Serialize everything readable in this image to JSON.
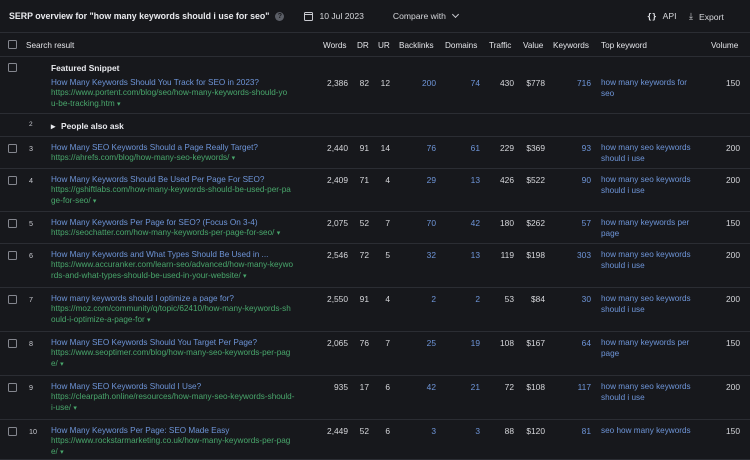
{
  "header": {
    "title": "SERP overview for \"how many keywords should i use for seo\"",
    "date": "10 Jul 2023",
    "compare_label": "Compare with",
    "api_label": "API",
    "export_label": "Export"
  },
  "columns": [
    "Search result",
    "Words",
    "DR",
    "UR",
    "Backlinks",
    "Domains",
    "Traffic",
    "Value",
    "Keywords",
    "Top keyword",
    "Volume"
  ],
  "featured": {
    "label": "Featured Snippet",
    "title": "How Many Keywords Should You Track for SEO in 2023?",
    "url_lines": [
      "https://www.portent.com/blog/seo/how-many-keywords-should-yo",
      "u-be-tracking.htm"
    ],
    "words": "2,386",
    "dr": "82",
    "ur": "12",
    "backlinks": "200",
    "domains": "74",
    "traffic": "430",
    "value": "$778",
    "keywords": "716",
    "top_keyword_lines": [
      "how many keywords for",
      "seo"
    ],
    "volume": "150"
  },
  "people_also_ask": {
    "position": "2",
    "label": "People also ask"
  },
  "rows": [
    {
      "pos": "3",
      "title": "How Many SEO Keywords Should a Page Really Target?",
      "url_lines": [
        "https://ahrefs.com/blog/how-many-seo-keywords/"
      ],
      "words": "2,440",
      "dr": "91",
      "ur": "14",
      "backlinks": "76",
      "domains": "61",
      "traffic": "229",
      "value": "$369",
      "keywords": "93",
      "top_keyword_lines": [
        "how many seo keywords",
        "should i use"
      ],
      "volume": "200"
    },
    {
      "pos": "4",
      "title": "How Many Keywords Should Be Used Per Page For SEO?",
      "url_lines": [
        "https://gshiftlabs.com/how-many-keywords-should-be-used-per-pa",
        "ge-for-seo/"
      ],
      "words": "2,409",
      "dr": "71",
      "ur": "4",
      "backlinks": "29",
      "domains": "13",
      "traffic": "426",
      "value": "$522",
      "keywords": "90",
      "top_keyword_lines": [
        "how many seo keywords",
        "should i use"
      ],
      "volume": "200"
    },
    {
      "pos": "5",
      "title": "How Many Keywords Per Page for SEO? (Focus On 3-4)",
      "url_lines": [
        "https://seochatter.com/how-many-keywords-per-page-for-seo/"
      ],
      "words": "2,075",
      "dr": "52",
      "ur": "7",
      "backlinks": "70",
      "domains": "42",
      "traffic": "180",
      "value": "$262",
      "keywords": "57",
      "top_keyword_lines": [
        "how many keywords per",
        "page"
      ],
      "volume": "150"
    },
    {
      "pos": "6",
      "title": "How Many Keywords and What Types Should Be Used in ...",
      "url_lines": [
        "https://www.accuranker.com/learn-seo/advanced/how-many-keywo",
        "rds-and-what-types-should-be-used-in-your-website/"
      ],
      "words": "2,546",
      "dr": "72",
      "ur": "5",
      "backlinks": "32",
      "domains": "13",
      "traffic": "119",
      "value": "$198",
      "keywords": "303",
      "top_keyword_lines": [
        "how many seo keywords",
        "should i use"
      ],
      "volume": "200"
    },
    {
      "pos": "7",
      "title": "How many keywords should I optimize a page for?",
      "url_lines": [
        "https://moz.com/community/q/topic/62410/how-many-keywords-sh",
        "ould-i-optimize-a-page-for"
      ],
      "words": "2,550",
      "dr": "91",
      "ur": "4",
      "backlinks": "2",
      "domains": "2",
      "traffic": "53",
      "value": "$84",
      "keywords": "30",
      "top_keyword_lines": [
        "how many seo keywords",
        "should i use"
      ],
      "volume": "200"
    },
    {
      "pos": "8",
      "title": "How Many SEO Keywords Should You Target Per Page?",
      "url_lines": [
        "https://www.seoptimer.com/blog/how-many-seo-keywords-per-pag",
        "e/"
      ],
      "words": "2,065",
      "dr": "76",
      "ur": "7",
      "backlinks": "25",
      "domains": "19",
      "traffic": "108",
      "value": "$167",
      "keywords": "64",
      "top_keyword_lines": [
        "how many keywords per",
        "page"
      ],
      "volume": "150"
    },
    {
      "pos": "9",
      "title": "How Many SEO Keywords Should I Use?",
      "url_lines": [
        "https://clearpath.online/resources/how-many-seo-keywords-should-",
        "i-use/"
      ],
      "words": "935",
      "dr": "17",
      "ur": "6",
      "backlinks": "42",
      "domains": "21",
      "traffic": "72",
      "value": "$108",
      "keywords": "117",
      "top_keyword_lines": [
        "how many seo keywords",
        "should i use"
      ],
      "volume": "200"
    },
    {
      "pos": "10",
      "title": "How Many Keywords Per Page: SEO Made Easy",
      "url_lines": [
        "https://www.rockstarmarketing.co.uk/how-many-keywords-per-pag",
        "e/"
      ],
      "words": "2,449",
      "dr": "52",
      "ur": "6",
      "backlinks": "3",
      "domains": "3",
      "traffic": "88",
      "value": "$120",
      "keywords": "81",
      "top_keyword_lines": [
        "seo how many keywords"
      ],
      "volume": "150"
    }
  ],
  "colors": {
    "background": "#17181c",
    "link": "#6e95d8",
    "url": "#49a76c",
    "divider": "#2b2d33"
  },
  "icons": {
    "help": "question-circle-icon",
    "calendar": "calendar-icon",
    "api": "code-braces-icon",
    "export": "download-icon",
    "expand": "triangle-right-icon",
    "url_menu": "caret-down-icon"
  }
}
